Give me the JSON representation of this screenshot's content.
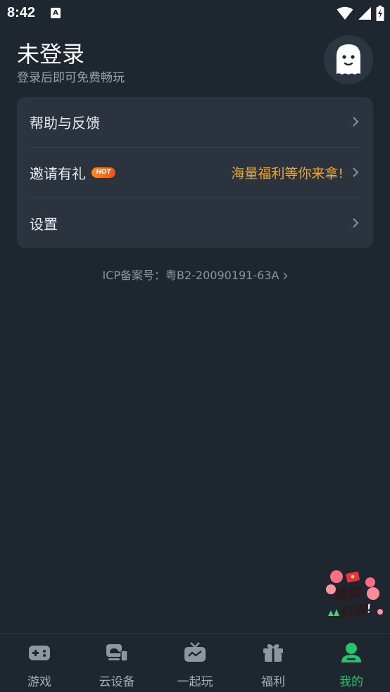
{
  "status_bar": {
    "time": "8:42",
    "a_icon": "A"
  },
  "header": {
    "title": "未登录",
    "subtitle": "登录后即可免费畅玩"
  },
  "menu": {
    "items": [
      {
        "label": "帮助与反馈"
      },
      {
        "label": "邀请有礼",
        "badge": "HOT",
        "promo": "海量福利等你来拿!"
      },
      {
        "label": "设置"
      }
    ]
  },
  "icp": {
    "text": "ICP备案号：粤B2-20090191-63A"
  },
  "invite_float": {
    "line1": "邀请",
    "line2": "红包!"
  },
  "bottom_nav": {
    "items": [
      {
        "label": "游戏",
        "icon": "gamepad-icon"
      },
      {
        "label": "云设备",
        "icon": "cloud-device-icon"
      },
      {
        "label": "一起玩",
        "icon": "tv-icon"
      },
      {
        "label": "福利",
        "icon": "gift-icon"
      },
      {
        "label": "我的",
        "icon": "user-icon"
      }
    ],
    "active_index": 4
  },
  "colors": {
    "accent": "#27c36b",
    "promo": "#f5a623",
    "background": "#1e262f",
    "card": "#2b343e"
  }
}
